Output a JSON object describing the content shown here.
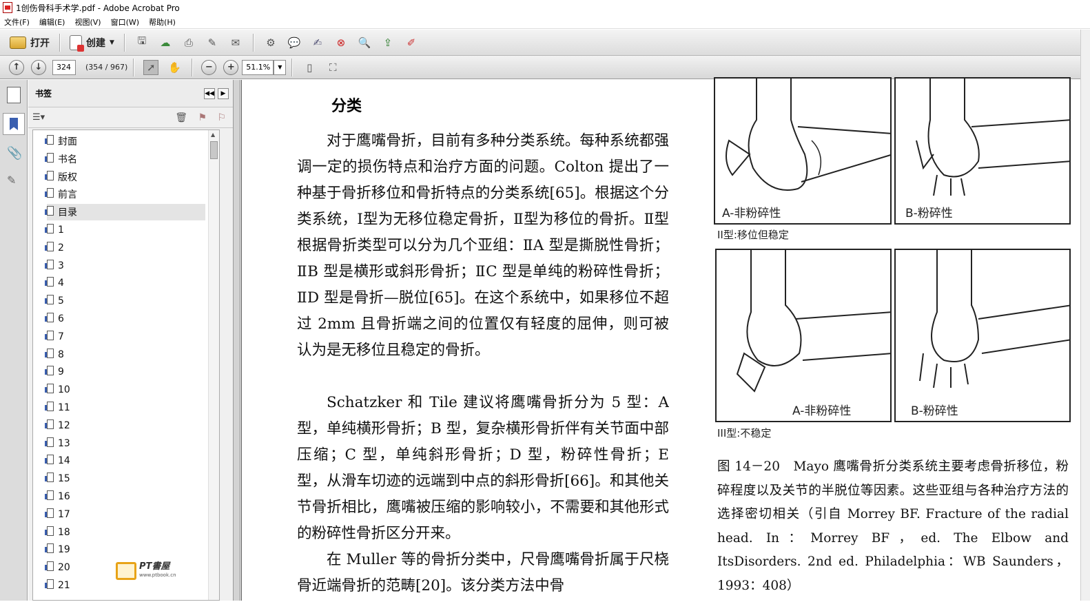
{
  "window": {
    "title": "1创伤骨科手术学.pdf - Adobe Acrobat Pro"
  },
  "menu": [
    "文件(F)",
    "编辑(E)",
    "视图(V)",
    "窗口(W)",
    "帮助(H)"
  ],
  "toolbar": {
    "open_label": "打开",
    "create_label": "创建"
  },
  "nav": {
    "page_number": "324",
    "page_count": "(354 / 967)",
    "zoom": "51.1%"
  },
  "panel": {
    "title": "书签",
    "bookmarks": [
      "封面",
      "书名",
      "版权",
      "前言",
      "目录",
      "1",
      "2",
      "3",
      "4",
      "5",
      "6",
      "7",
      "8",
      "9",
      "10",
      "11",
      "12",
      "13",
      "14",
      "15",
      "16",
      "17",
      "18",
      "19",
      "20",
      "21"
    ],
    "selected_index": 4
  },
  "watermark": {
    "text": "PT書屋",
    "url": "www.ptbook.cn"
  },
  "document": {
    "heading": "分类",
    "paragraphs": [
      "对于鹰嘴骨折，目前有多种分类系统。每种系统都强调一定的损伤特点和治疗方面的问题。Colton 提出了一种基于骨折移位和骨折特点的分类系统[65]。根据这个分类系统，Ⅰ型为无移位稳定骨折，Ⅱ型为移位的骨折。Ⅱ型根据骨折类型可以分为几个亚组：ⅡA 型是撕脱性骨折；ⅡB 型是横形或斜形骨折；ⅡC 型是单纯的粉碎性骨折；ⅡD 型是骨折—脱位[65]。在这个系统中，如果移位不超过 2mm 且骨折端之间的位置仅有轻度的屈伸，则可被认为是无移位且稳定的骨折。",
      "Schatzker 和 Tile 建议将鹰嘴骨折分为 5 型：A 型，单纯横形骨折；B 型，复杂横形骨折伴有关节面中部压缩；C 型，单纯斜形骨折；D 型，粉碎性骨折；E 型，从滑车切迹的远端到中点的斜形骨折[66]。和其他关节骨折相比，鹰嘴被压缩的影响较小，不需要和其他形式的粉碎性骨折区分开来。",
      "在 Muller 等的骨折分类中，尺骨鹰嘴骨折属于尺桡骨近端骨折的范畴[20]。该分类方法中骨"
    ],
    "figures": {
      "top_left_label": "A-非粉碎性",
      "top_right_label": "B-粉碎性",
      "top_caption": "II型:移位但稳定",
      "bottom_left_label": "A-非粉碎性",
      "bottom_right_label": "B-粉碎性",
      "bottom_caption": "III型:不稳定"
    },
    "caption": "图 14－20　Mayo 鹰嘴骨折分类系统主要考虑骨折移位，粉碎程度以及关节的半脱位等因素。这些亚组与各种治疗方法的选择密切相关（引自 Morrey BF. Fracture of the radial head. In：Morrey BF，ed. The Elbow and ItsDisorders. 2nd ed. Philadelphia：WB Saunders，1993：408）"
  }
}
